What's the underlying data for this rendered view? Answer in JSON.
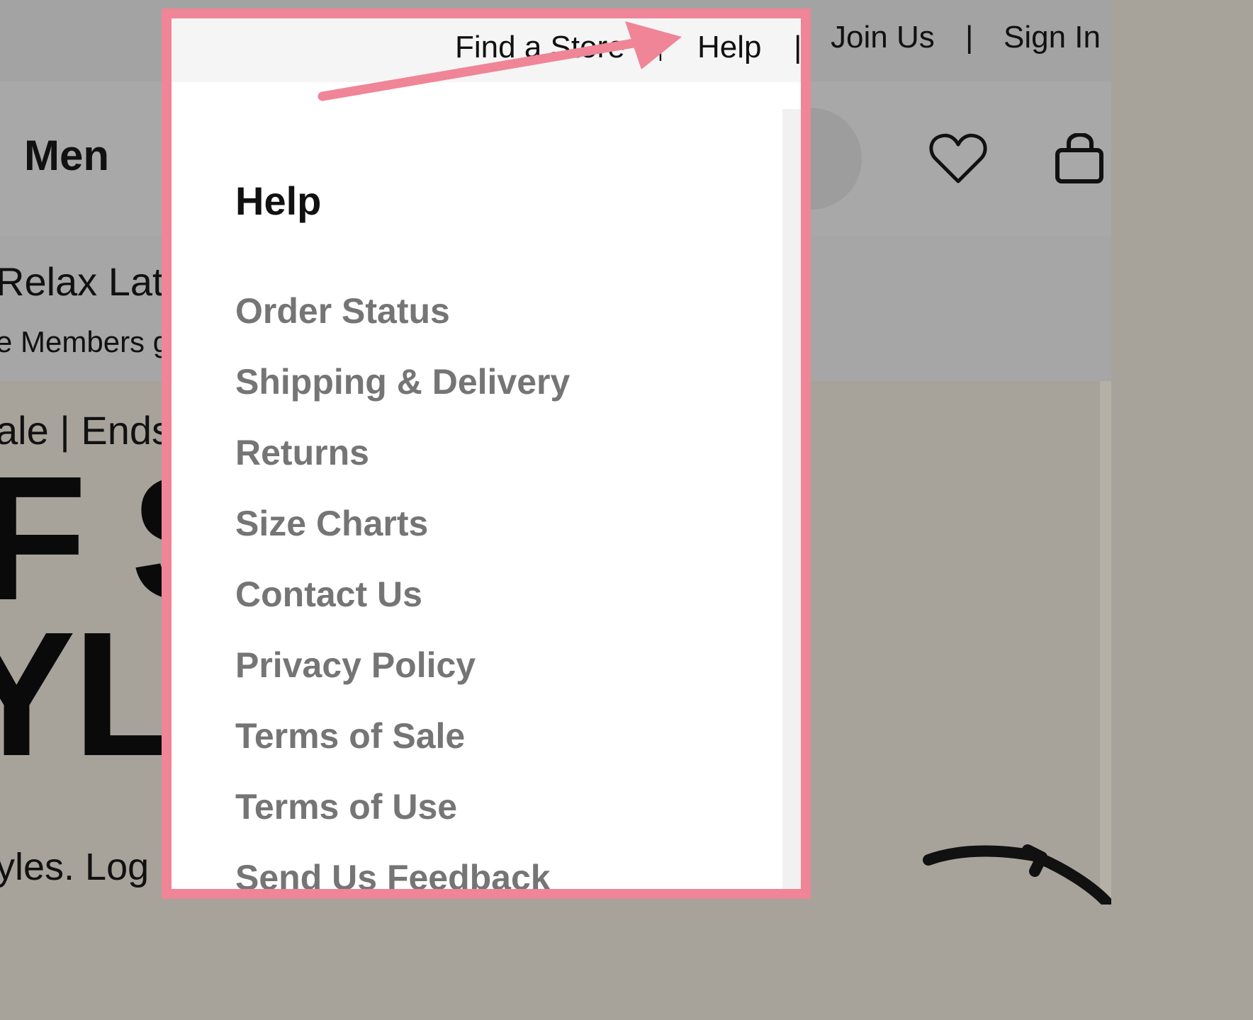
{
  "utility_nav": {
    "find_store": "Find a Store",
    "help": "Help",
    "join": "Join Us",
    "sign_in": "Sign In",
    "separator": "|"
  },
  "main_nav": {
    "men": "Men"
  },
  "promo": {
    "title_fragment": "Relax Lat",
    "subtitle_fragment": "e Members g"
  },
  "hero": {
    "line_fragment": "ale | Ends",
    "big_line1": "F S",
    "big_line2": "YLES",
    "tail_fragment": "yles. Log"
  },
  "help_menu": {
    "heading": "Help",
    "items": [
      "Order Status",
      "Shipping & Delivery",
      "Returns",
      "Size Charts",
      "Contact Us",
      "Privacy Policy",
      "Terms of Sale",
      "Terms of Use",
      "Send Us Feedback"
    ]
  },
  "icons": {
    "favorites": "heart-icon",
    "bag": "bag-icon",
    "annotation": "arrow-icon"
  },
  "colors": {
    "highlight_frame": "#ef8597",
    "menu_item_text": "#757575"
  }
}
